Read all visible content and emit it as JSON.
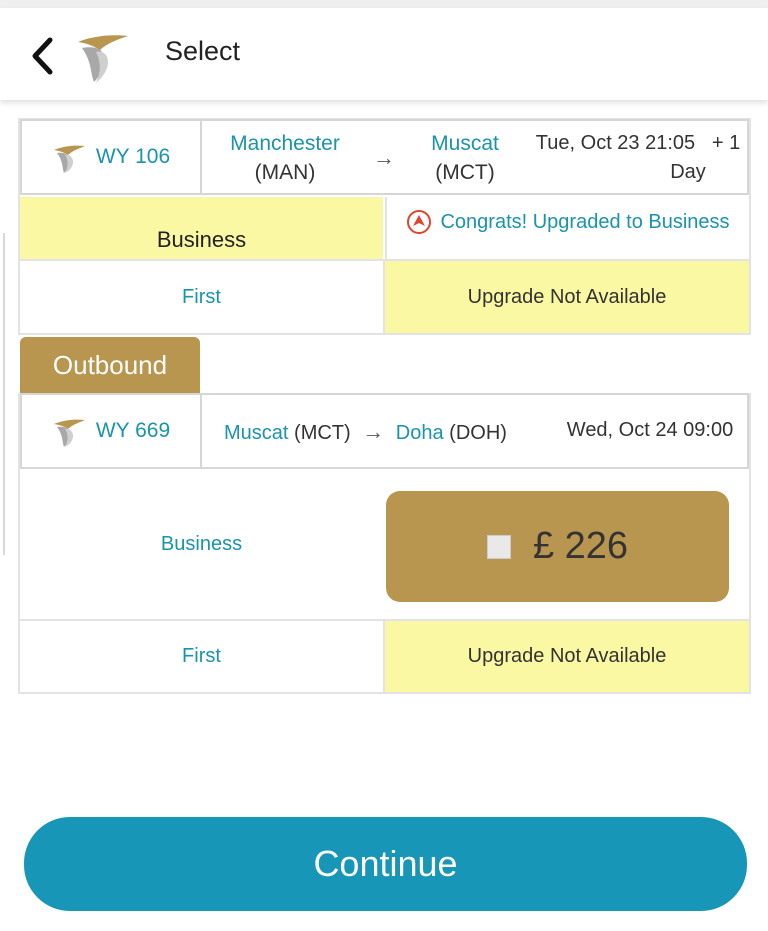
{
  "header": {
    "title": "Select",
    "back_icon": "chevron-left-icon",
    "logo_icon": "airline-logo-icon"
  },
  "flight1": {
    "code": "WY 106",
    "origin_city": "Manchester",
    "origin_code": "(MAN)",
    "arrow": "→",
    "dest_city": "Muscat",
    "dest_code": "(MCT)",
    "datetime": "Tue, Oct 23 21:05",
    "day_offset_a": "+ 1",
    "day_offset_b": "Day",
    "current_class": "Business",
    "upgrade_status": "Congrats! Upgraded to Business",
    "upgrade_icon": "upgrade-arrow-icon",
    "row2_class": "First",
    "row2_status": "Upgrade Not Available"
  },
  "outbound_tab": "Outbound",
  "flight2": {
    "code": "WY 669",
    "origin_city": "Muscat",
    "origin_code": "(MCT)",
    "arrow": "→",
    "dest_city": "Doha",
    "dest_code": "(DOH)",
    "datetime": "Wed, Oct 24 09:00",
    "row1_class": "Business",
    "row1_price": "£ 226",
    "row2_class": "First",
    "row2_status": "Upgrade Not Available"
  },
  "continue_label": "Continue",
  "colors": {
    "accent_teal": "#1a94ac",
    "gold": "#b9964f",
    "highlight_yellow": "#fbf8a3",
    "continue_blue": "#1896b7"
  }
}
